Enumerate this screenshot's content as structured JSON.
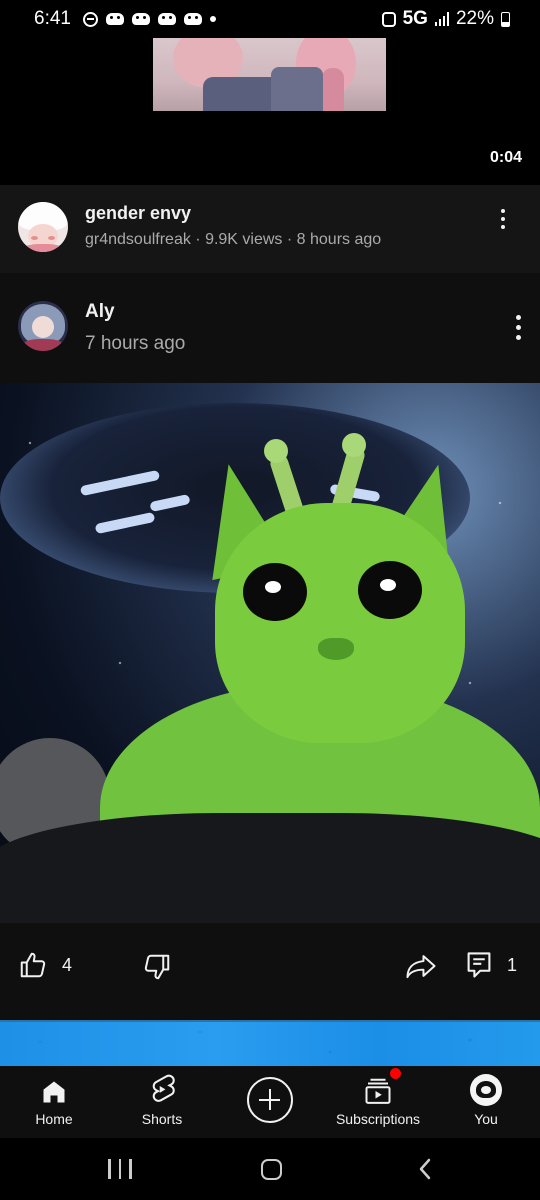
{
  "status_bar": {
    "time": "6:41",
    "network": "5G",
    "battery": "22%",
    "icons": [
      "do-not-disturb-icon",
      "game-icon",
      "game-icon",
      "game-icon",
      "game-icon",
      "notification-dot-icon",
      "alarm-icon",
      "signal-icon",
      "battery-icon"
    ]
  },
  "video": {
    "duration": "0:04",
    "title": "gender envy",
    "channel": "gr4ndsoulfreak",
    "views": "9.9K views",
    "age": "8 hours ago",
    "meta": "gr4ndsoulfreak · 9.9K views · 8 hours ago"
  },
  "post": {
    "author": "Aly",
    "time": "7 hours ago",
    "likes": "4",
    "comments": "1"
  },
  "bottom_nav": {
    "items": [
      {
        "label": "Home",
        "icon": "home-icon"
      },
      {
        "label": "Shorts",
        "icon": "shorts-icon"
      },
      {
        "label": "",
        "icon": "create-icon"
      },
      {
        "label": "Subscriptions",
        "icon": "subscriptions-icon"
      },
      {
        "label": "You",
        "icon": "account-avatar"
      }
    ]
  },
  "colors": {
    "background": "#0f0f0f",
    "text_primary": "#f1f1f1",
    "text_secondary": "#aaaaaa",
    "notification": "#ff0000",
    "banner": "#1e90e6"
  }
}
